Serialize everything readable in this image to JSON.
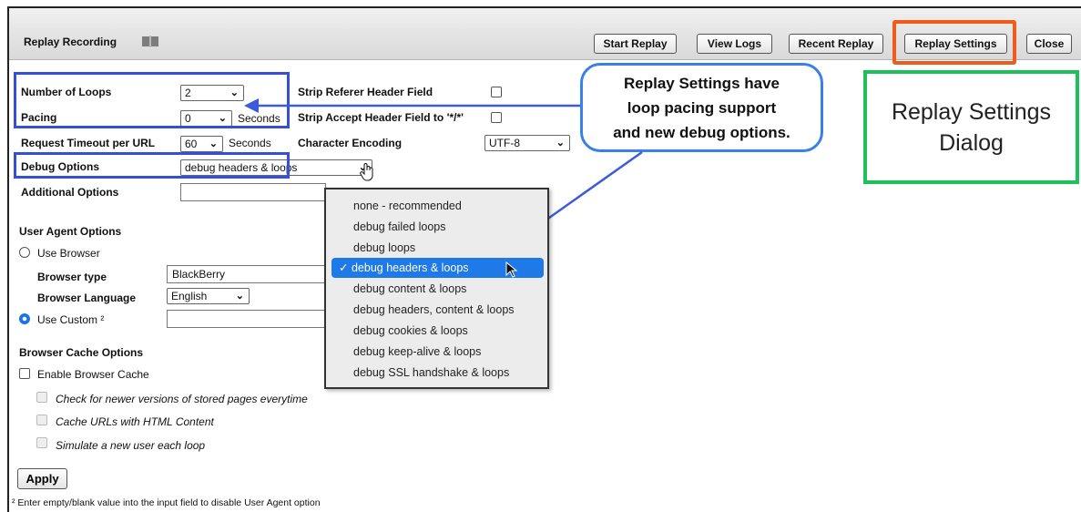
{
  "header": {
    "title": "Replay Recording",
    "buttons": {
      "start_replay": "Start Replay",
      "view_logs": "View Logs",
      "recent_replay": "Recent Replay",
      "replay_settings": "Replay Settings",
      "close": "Close"
    }
  },
  "form": {
    "number_of_loops_label": "Number of Loops",
    "number_of_loops_value": "2",
    "pacing_label": "Pacing",
    "pacing_value": "0",
    "pacing_unit": "Seconds",
    "timeout_label": "Request Timeout per URL",
    "timeout_value": "60",
    "timeout_unit": "Seconds",
    "debug_label": "Debug Options",
    "debug_value": "debug headers & loops",
    "additional_label": "Additional Options",
    "strip_referer_label": "Strip Referer Header Field",
    "strip_accept_label": "Strip Accept Header Field to '*/*'",
    "encoding_label": "Character Encoding",
    "encoding_value": "UTF-8"
  },
  "user_agent": {
    "section_title": "User Agent Options",
    "use_browser_label": "Use Browser",
    "browser_type_label": "Browser type",
    "browser_type_value": "BlackBerry",
    "browser_language_label": "Browser Language",
    "browser_language_value": "English",
    "use_custom_label": "Use Custom ²"
  },
  "cache": {
    "section_title": "Browser Cache Options",
    "enable_label": "Enable Browser Cache",
    "check_newer_label": "Check for newer versions of stored pages everytime",
    "cache_urls_label": "Cache URLs with HTML Content",
    "simulate_label": "Simulate a new user each loop"
  },
  "apply_label": "Apply",
  "footnote": "² Enter empty/blank value into the input field to disable User Agent option",
  "dropdown": {
    "items": [
      "none - recommended",
      "debug failed loops",
      "debug loops",
      "debug headers & loops",
      "debug content & loops",
      "debug headers, content & loops",
      "debug cookies & loops",
      "debug keep-alive & loops",
      "debug SSL handshake & loops"
    ],
    "selected_mark": "✓"
  },
  "annotations": {
    "bubble_line1": "Replay Settings have",
    "bubble_line2": "loop pacing support",
    "bubble_line3": "and new debug options.",
    "dialog_line1": "Replay Settings",
    "dialog_line2": "Dialog"
  },
  "colors": {
    "highlight_blue": "#3550d6",
    "replay_settings_orange": "#f05a1a",
    "dialog_green": "#1ec05a",
    "selection_blue": "#1f7ae8"
  }
}
